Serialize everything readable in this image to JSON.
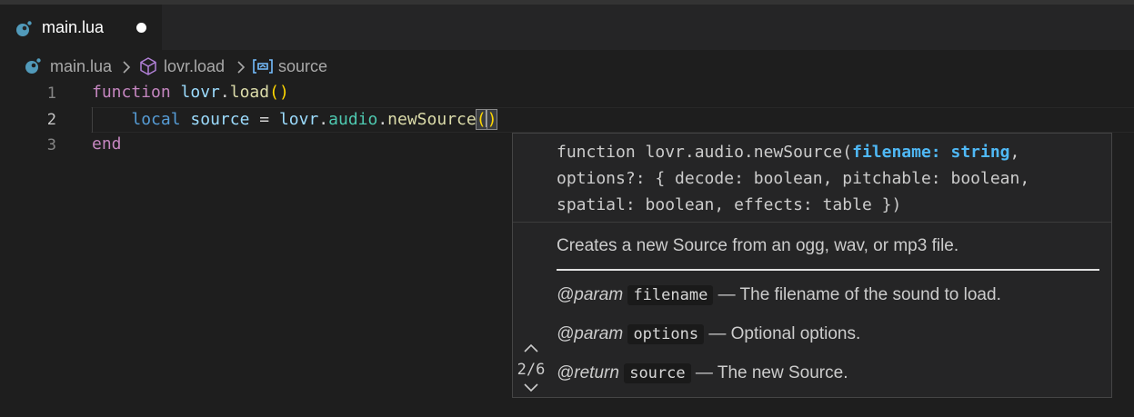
{
  "tab": {
    "label": "main.lua",
    "icon": "lua-file-icon",
    "dirty": true
  },
  "breadcrumb": {
    "items": [
      {
        "label": "main.lua",
        "icon": "lua-file-icon"
      },
      {
        "label": "lovr.load",
        "icon": "cube-icon"
      },
      {
        "label": "source",
        "icon": "variable-icon"
      }
    ],
    "separator_icon": "chevron-right-icon"
  },
  "editor": {
    "line_numbers": [
      "1",
      "2",
      "3"
    ],
    "active_line": "2",
    "lines": [
      {
        "kw": "function",
        "sp": " ",
        "obj": "lovr",
        "dot": ".",
        "fn": "load",
        "parens": "()"
      },
      {
        "indent": "    ",
        "kw": "local",
        "sp1": " ",
        "var": "source",
        "eq": " = ",
        "obj": "lovr",
        "dot1": ".",
        "mod": "audio",
        "dot2": ".",
        "fn": "newSource",
        "open": "(",
        "close": ")"
      },
      {
        "kw": "end"
      }
    ]
  },
  "signature_help": {
    "sig_prefix": "function lovr.audio.newSource(",
    "active_param": "filename: string",
    "sig_rest_1": ",",
    "sig_line_2": "options?: { decode: boolean, pitchable: boolean,",
    "sig_line_3": "spatial: boolean, effects: table })",
    "description": "Creates a new Source from an ogg, wav, or mp3 file.",
    "params": [
      {
        "tag": "@param",
        "name": "filename",
        "text": " — The filename of the sound to load."
      },
      {
        "tag": "@param",
        "name": "options",
        "text": " — Optional options."
      },
      {
        "tag": "@return",
        "name": "source",
        "text": " — The new Source."
      }
    ],
    "overload_counter": "2/6",
    "up_icon": "chevron-up-icon",
    "down_icon": "chevron-down-icon"
  },
  "colors": {
    "background": "#1e1e1e",
    "keyword": "#c586c0",
    "local_keyword": "#569cd6",
    "variable": "#9cdcfe",
    "function": "#dcdcaa",
    "module": "#4ec9b0",
    "bracket": "#ffd700",
    "active_param": "#4fb8f5",
    "lua_icon": "#519aba"
  }
}
